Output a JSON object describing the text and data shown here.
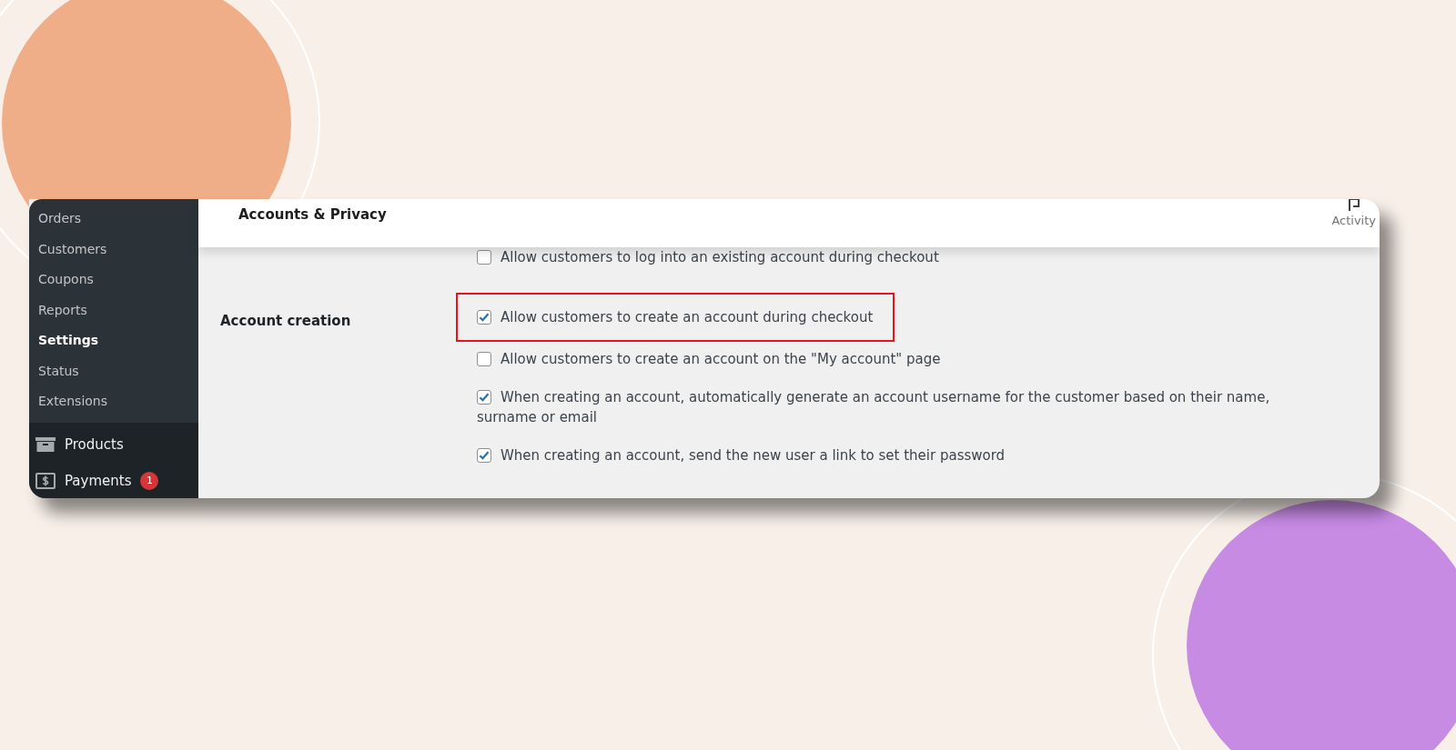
{
  "sidebar": {
    "submenu": [
      {
        "label": "Orders",
        "selected": false
      },
      {
        "label": "Customers",
        "selected": false
      },
      {
        "label": "Coupons",
        "selected": false
      },
      {
        "label": "Reports",
        "selected": false
      },
      {
        "label": "Settings",
        "selected": true
      },
      {
        "label": "Status",
        "selected": false
      },
      {
        "label": "Extensions",
        "selected": false
      }
    ],
    "menu": [
      {
        "label": "Products",
        "kind": "box"
      },
      {
        "label": "Payments",
        "kind": "dollar",
        "badge": "1"
      }
    ]
  },
  "header": {
    "title": "Accounts & Privacy",
    "activity": "Activity"
  },
  "settings": [
    {
      "options": [
        {
          "text": "Allow customers to log into an existing account during checkout",
          "checked": false,
          "highlighted": false
        }
      ]
    },
    {
      "label": "Account creation",
      "options": [
        {
          "text": "Allow customers to create an account during checkout",
          "checked": true,
          "highlighted": true
        },
        {
          "text": "Allow customers to create an account on the \"My account\" page",
          "checked": false,
          "highlighted": false
        },
        {
          "text": "When creating an account, automatically generate an account username for the customer based on their name, surname or email",
          "checked": true,
          "highlighted": false
        },
        {
          "text": "When creating an account, send the new user a link to set their password",
          "checked": true,
          "highlighted": false
        }
      ]
    }
  ]
}
